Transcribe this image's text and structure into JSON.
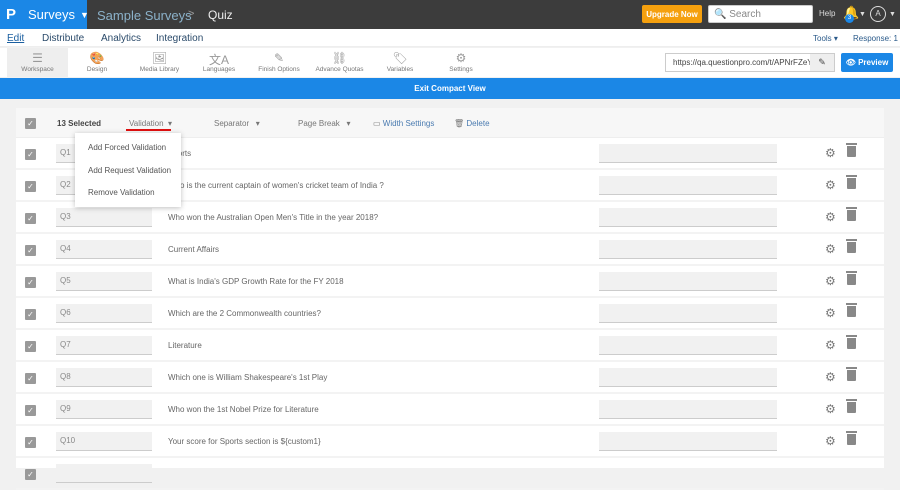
{
  "topbar": {
    "logo": "P",
    "app": "Surveys",
    "crumbs": [
      "Sample Surveys",
      "Quiz"
    ],
    "upgrade": "Upgrade Now",
    "search_placeholder": "Search",
    "help": "Help",
    "notifications": "3",
    "avatar": "A"
  },
  "nav": {
    "tabs": [
      "Edit",
      "Distribute",
      "Analytics",
      "Integration"
    ],
    "tools": "Tools ▾",
    "response": "Response: 1"
  },
  "toolbar": {
    "items": [
      {
        "label": "Workspace",
        "icon": "☰"
      },
      {
        "label": "Design",
        "icon": "🎨"
      },
      {
        "label": "Media Library",
        "icon": "🖼"
      },
      {
        "label": "Languages",
        "icon": "文A"
      },
      {
        "label": "Finish Options",
        "icon": "✎"
      },
      {
        "label": "Advance Quotas",
        "icon": "⛓"
      },
      {
        "label": "Variables",
        "icon": "🏷"
      },
      {
        "label": "Settings",
        "icon": "⚙"
      }
    ],
    "url": "https://qa.questionpro.com/t/APNrFZeY",
    "preview": "Preview"
  },
  "exit_compact": "Exit Compact View",
  "bulk": {
    "selected": "13 Selected",
    "validation": "Validation",
    "separator": "Separator",
    "page_break": "Page Break",
    "width_settings": "Width Settings",
    "delete": "Delete"
  },
  "validation_menu": [
    "Add Forced Validation",
    "Add Request Validation",
    "Remove Validation"
  ],
  "questions": [
    {
      "label": "Q1",
      "text": "Sports"
    },
    {
      "label": "Q2",
      "text": "Who is the current captain of women's cricket team of India ?"
    },
    {
      "label": "Q3",
      "text": "Who won the Australian Open Men's Title in the year 2018?"
    },
    {
      "label": "Q4",
      "text": "Current Affairs"
    },
    {
      "label": "Q5",
      "text": "What is India's GDP Growth Rate for the FY 2018"
    },
    {
      "label": "Q6",
      "text": "Which are the 2 Commonwealth countries?"
    },
    {
      "label": "Q7",
      "text": "Literature"
    },
    {
      "label": "Q8",
      "text": "Which one is William Shakespeare's 1st Play"
    },
    {
      "label": "Q9",
      "text": "Who won the 1st Nobel Prize for Literature"
    },
    {
      "label": "Q10",
      "text": "Your score for Sports section is ${custom1}"
    }
  ]
}
